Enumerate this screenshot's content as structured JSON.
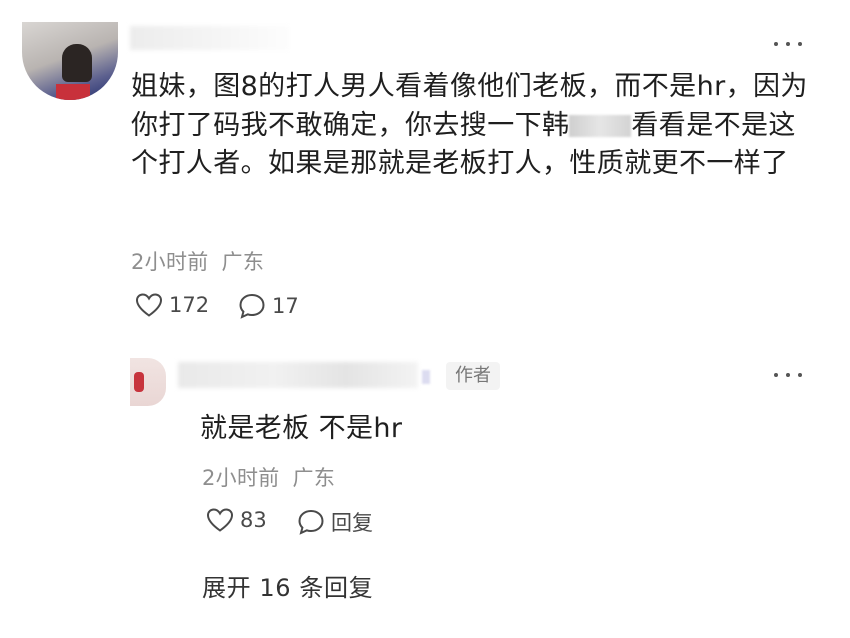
{
  "comment": {
    "text_before_censor": "姐妹，图8的打人男人看着像他们老板，而不是hr，因为你打了码我不敢确定，你去搜一下韩",
    "text_after_censor": "看看是不是这个打人者。如果是那就是老板打人，性质就更不一样了",
    "time": "2小时前",
    "location": "广东",
    "like_count": "172",
    "reply_count": "17",
    "icons": {
      "more": "more-dots-icon",
      "like": "heart-icon",
      "reply": "speech-bubble-icon"
    }
  },
  "reply": {
    "author_badge": "作者",
    "text": "就是老板 不是hr",
    "time": "2小时前",
    "location": "广东",
    "like_count": "83",
    "reply_label": "回复"
  },
  "expand": {
    "label": "展开 16 条回复"
  },
  "colors": {
    "text": "#1f1f1f",
    "meta": "#8e8e8e",
    "badge_bg": "#f3f3f3"
  }
}
